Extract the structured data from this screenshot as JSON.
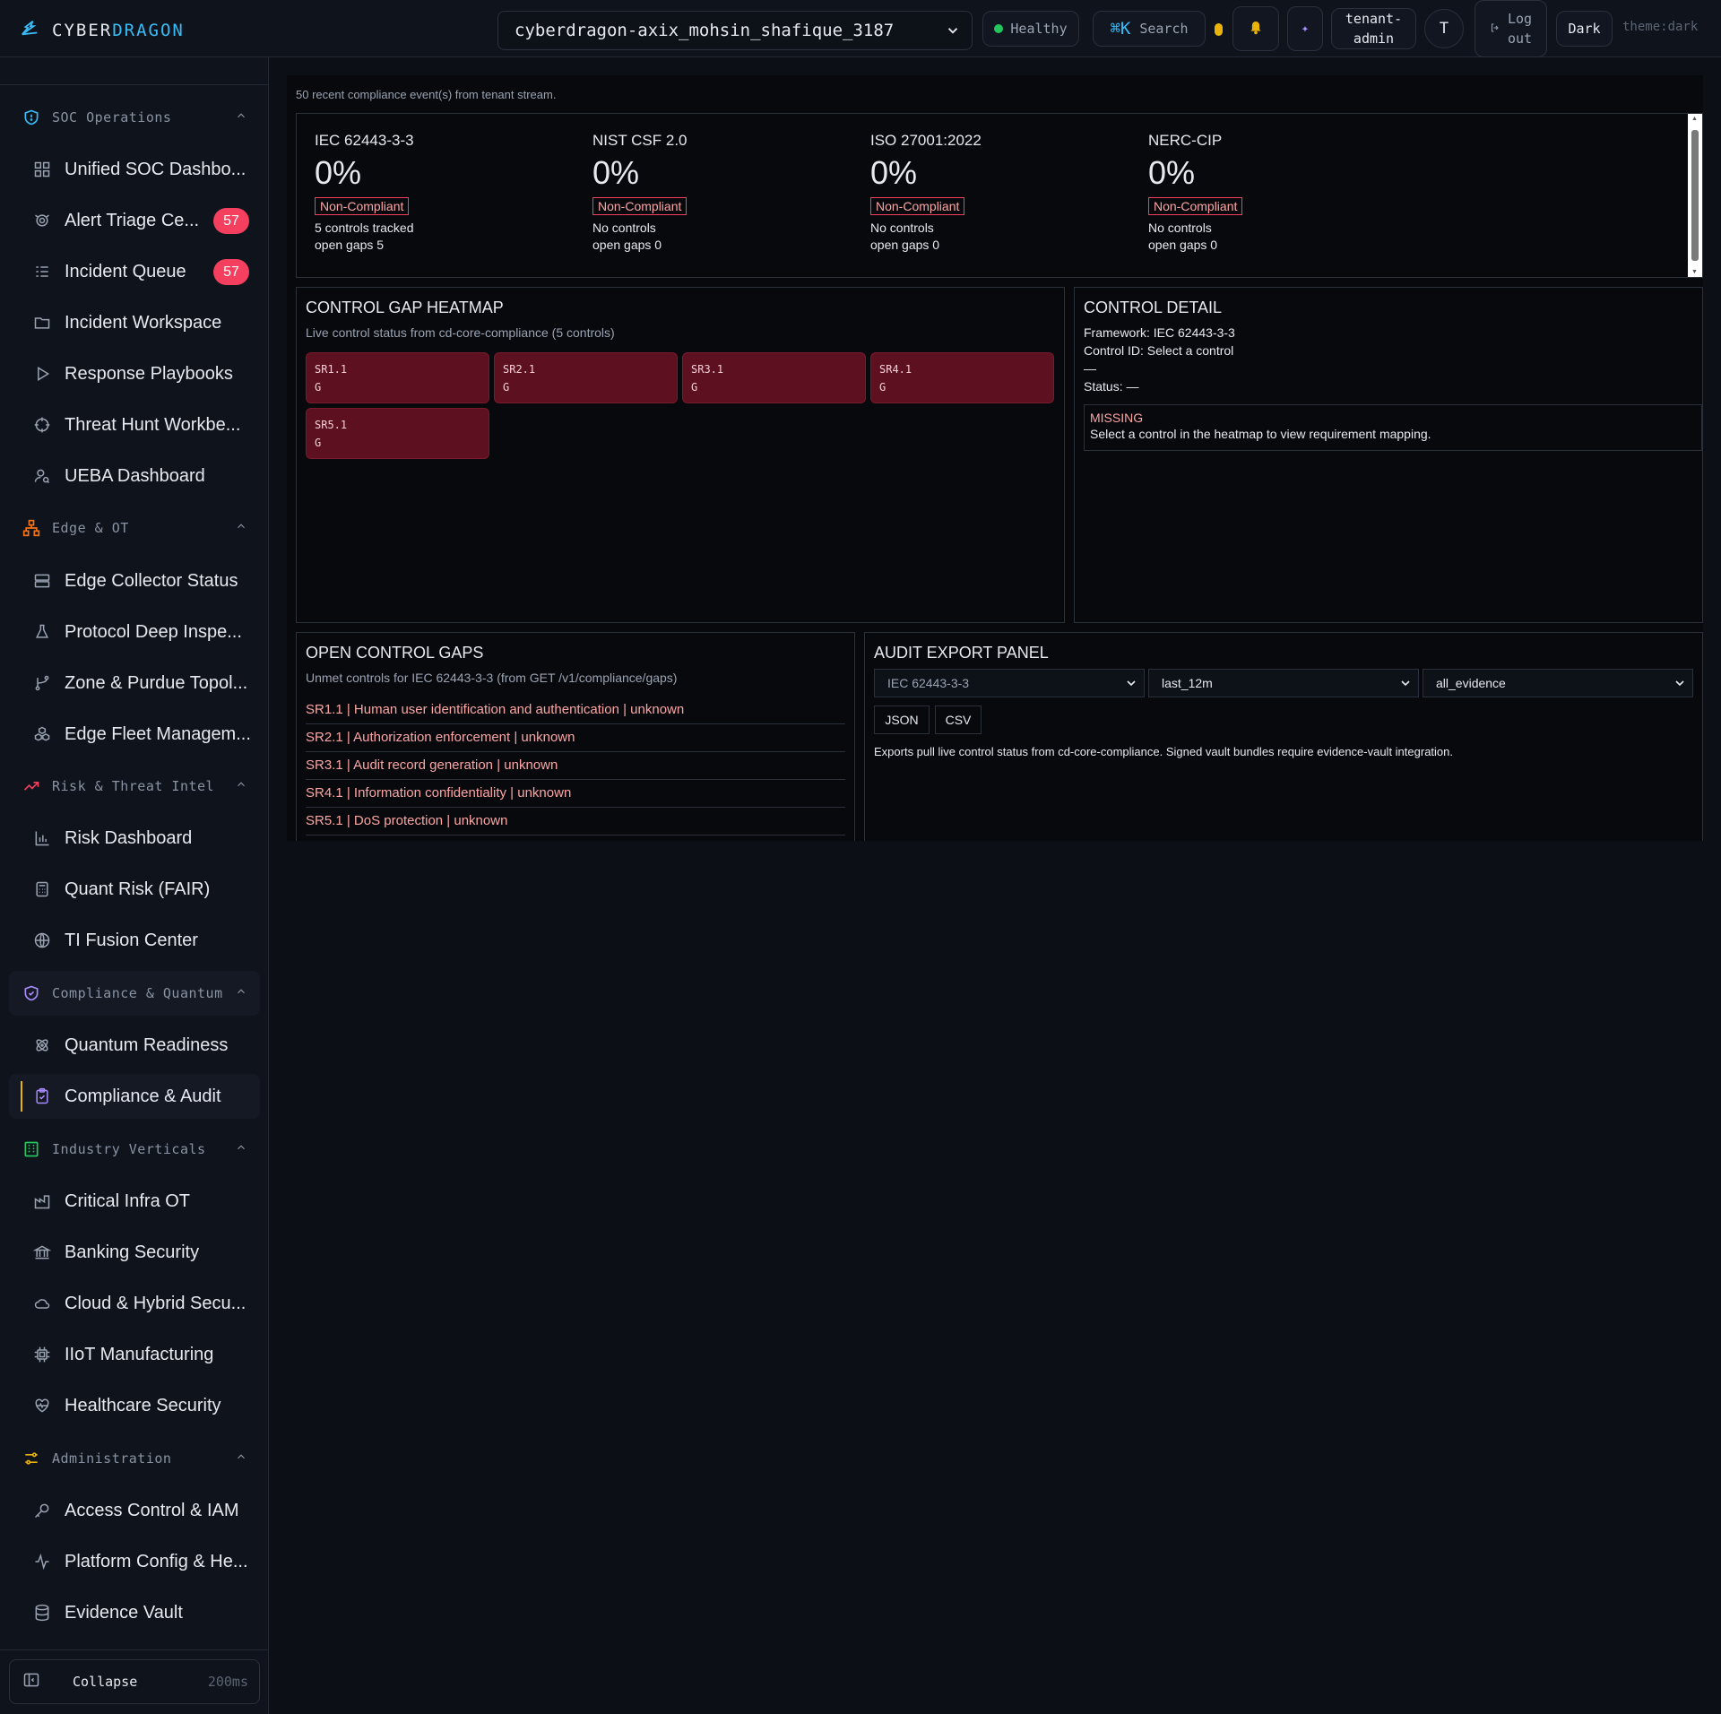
{
  "brand": {
    "part1": "CYBER",
    "part2": "DRAGON"
  },
  "topbar": {
    "tenant": "cyberdragon-axix_mohsin_shafique_3187",
    "health": "Healthy",
    "search_kbd": "⌘K",
    "search_label": "Search",
    "role_line1": "tenant-",
    "role_line2": "admin",
    "avatar": "T",
    "logout_line1": "Log",
    "logout_line2": "out",
    "theme_button": "Dark",
    "theme_tag": "theme:dark"
  },
  "sidebar": {
    "sections": [
      {
        "label": "SOC Operations",
        "color": "#38bdf8",
        "items": [
          {
            "label": "Unified SOC Dashbo...",
            "icon": "grid-icon"
          },
          {
            "label": "Alert Triage Ce...",
            "icon": "radar-icon",
            "badge": "57"
          },
          {
            "label": "Incident Queue",
            "icon": "list-icon",
            "badge": "57"
          },
          {
            "label": "Incident Workspace",
            "icon": "folder-icon"
          },
          {
            "label": "Response Playbooks",
            "icon": "play-icon"
          },
          {
            "label": "Threat Hunt Workbe...",
            "icon": "crosshair-icon"
          },
          {
            "label": "UEBA Dashboard",
            "icon": "user-search-icon"
          }
        ]
      },
      {
        "label": "Edge & OT",
        "color": "#f97316",
        "items": [
          {
            "label": "Edge Collector Status",
            "icon": "server-icon"
          },
          {
            "label": "Protocol Deep Inspe...",
            "icon": "flask-icon"
          },
          {
            "label": "Zone & Purdue Topol...",
            "icon": "branch-icon"
          },
          {
            "label": "Edge Fleet Managem...",
            "icon": "boxes-icon"
          }
        ]
      },
      {
        "label": "Risk & Threat Intel",
        "color": "#f43f5e",
        "items": [
          {
            "label": "Risk Dashboard",
            "icon": "bar-chart-icon"
          },
          {
            "label": "Quant Risk (FAIR)",
            "icon": "calculator-icon"
          },
          {
            "label": "TI Fusion Center",
            "icon": "globe-icon"
          }
        ]
      },
      {
        "label": "Compliance & Quantum",
        "color": "#a78bfa",
        "items": [
          {
            "label": "Quantum Readiness",
            "icon": "atom-icon"
          },
          {
            "label": "Compliance & Audit",
            "icon": "clipboard-check-icon",
            "active": true
          }
        ]
      },
      {
        "label": "Industry Verticals",
        "color": "#22c55e",
        "items": [
          {
            "label": "Critical Infra OT",
            "icon": "factory-icon"
          },
          {
            "label": "Banking Security",
            "icon": "bank-icon"
          },
          {
            "label": "Cloud & Hybrid Secu...",
            "icon": "cloud-icon"
          },
          {
            "label": "IIoT Manufacturing",
            "icon": "chip-icon"
          },
          {
            "label": "Healthcare Security",
            "icon": "heart-pulse-icon"
          }
        ]
      },
      {
        "label": "Administration",
        "color": "#eab308",
        "items": [
          {
            "label": "Access Control & IAM",
            "icon": "key-icon"
          },
          {
            "label": "Platform Config & He...",
            "icon": "activity-icon"
          },
          {
            "label": "Evidence Vault",
            "icon": "database-icon"
          }
        ]
      }
    ],
    "collapse_label": "Collapse",
    "collapse_timing": "200ms"
  },
  "main": {
    "events_note": "50 recent compliance event(s) from tenant stream.",
    "frameworks": [
      {
        "name": "IEC 62443-3-3",
        "score": "0%",
        "status": "Non-Compliant",
        "line1": "5 controls tracked",
        "line2": "open gaps 5"
      },
      {
        "name": "NIST CSF 2.0",
        "score": "0%",
        "status": "Non-Compliant",
        "line1": "No controls",
        "line2": "open gaps 0"
      },
      {
        "name": "ISO 27001:2022",
        "score": "0%",
        "status": "Non-Compliant",
        "line1": "No controls",
        "line2": "open gaps 0"
      },
      {
        "name": "NERC-CIP",
        "score": "0%",
        "status": "Non-Compliant",
        "line1": "No controls",
        "line2": "open gaps 0"
      }
    ],
    "heatmap": {
      "title": "CONTROL GAP HEATMAP",
      "subtitle": "Live control status from cd-core-compliance (5 controls)",
      "tiles": [
        {
          "id": "SR1.1",
          "grade": "G"
        },
        {
          "id": "SR2.1",
          "grade": "G"
        },
        {
          "id": "SR3.1",
          "grade": "G"
        },
        {
          "id": "SR4.1",
          "grade": "G"
        },
        {
          "id": "SR5.1",
          "grade": "G"
        }
      ]
    },
    "detail": {
      "title": "CONTROL DETAIL",
      "framework": "Framework: IEC 62443-3-3",
      "control_id": "Control ID: Select a control",
      "dash": "—",
      "status": "Status: —",
      "missing_title": "MISSING",
      "missing_text": "Select a control in the heatmap to view requirement mapping."
    },
    "gaps": {
      "title": "OPEN CONTROL GAPS",
      "subtitle": "Unmet controls for IEC 62443-3-3 (from GET /v1/compliance/gaps)",
      "rows": [
        "SR1.1 | Human user identification and authentication | unknown",
        "SR2.1 | Authorization enforcement | unknown",
        "SR3.1 | Audit record generation | unknown",
        "SR4.1 | Information confidentiality | unknown",
        "SR5.1 | DoS protection | unknown"
      ]
    },
    "export": {
      "title": "AUDIT EXPORT PANEL",
      "framework": "IEC 62443-3-3",
      "range": "last_12m",
      "scope": "all_evidence",
      "json_label": "JSON",
      "csv_label": "CSV",
      "note": "Exports pull live control status from cd-core-compliance. Signed vault bundles require evidence-vault integration."
    }
  }
}
